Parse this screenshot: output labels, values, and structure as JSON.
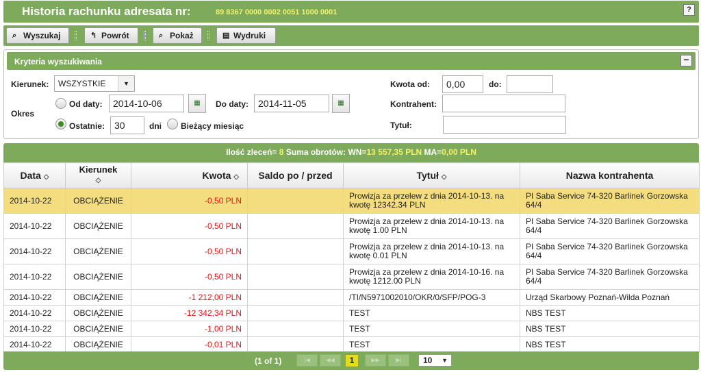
{
  "header": {
    "title": "Historia rachunku adresata nr:",
    "account": "89 8367 0000 0002 0051 1000 0001",
    "help_label": "?"
  },
  "toolbar": {
    "search_label": "Wyszukaj",
    "back_label": "Powrót",
    "show_label": "Pokaż",
    "print_label": "Wydruki"
  },
  "criteria": {
    "title": "Kryteria wyszukiwania",
    "collapse_label": "−",
    "direction_label": "Kierunek:",
    "direction_value": "WSZYSTKIE",
    "period_label": "Okres",
    "from_date_label": "Od daty:",
    "from_date_value": "2014-10-06",
    "to_date_label": "Do daty:",
    "to_date_value": "2014-11-05",
    "last_label": "Ostatnie:",
    "last_value": "30",
    "days_label": "dni",
    "current_month_label": "Bieżący miesiąc",
    "amount_from_label": "Kwota od:",
    "amount_from_value": "0,00",
    "amount_to_label": "do:",
    "amount_to_value": "",
    "counterparty_label": "Kontrahent:",
    "counterparty_value": "",
    "title_label": "Tytuł:",
    "title_value": ""
  },
  "summary": {
    "count_label": "Ilość zleceń=",
    "count_value": "8",
    "turnover_label": "Suma obrotów:",
    "wn_label": "WN=",
    "wn_value": "13 557,35 PLN",
    "ma_label": "MA=",
    "ma_value": "0,00 PLN"
  },
  "table": {
    "headers": {
      "date": "Data",
      "direction": "Kierunek",
      "amount": "Kwota",
      "balance": "Saldo po / przed",
      "title": "Tytuł",
      "counterparty": "Nazwa kontrahenta"
    },
    "rows": [
      {
        "date": "2014-10-22",
        "direction": "OBCIĄŻENIE",
        "amount": "-0,50 PLN",
        "balance": "",
        "title": "Prowizja za przelew z dnia 2014-10-13. na kwotę 12342.34 PLN",
        "counterparty": "PI Saba Service 74-320 Barlinek Gorzowska 64/4"
      },
      {
        "date": "2014-10-22",
        "direction": "OBCIĄŻENIE",
        "amount": "-0,50 PLN",
        "balance": "",
        "title": "Prowizja za przelew z dnia 2014-10-13. na kwotę 1.00 PLN",
        "counterparty": "PI Saba Service 74-320 Barlinek Gorzowska 64/4"
      },
      {
        "date": "2014-10-22",
        "direction": "OBCIĄŻENIE",
        "amount": "-0,50 PLN",
        "balance": "",
        "title": "Prowizja za przelew z dnia 2014-10-13. na kwotę 0.01 PLN",
        "counterparty": "PI Saba Service 74-320 Barlinek Gorzowska 64/4"
      },
      {
        "date": "2014-10-22",
        "direction": "OBCIĄŻENIE",
        "amount": "-0,50 PLN",
        "balance": "",
        "title": "Prowizja za przelew z dnia 2014-10-16. na kwotę 1212.00 PLN",
        "counterparty": "PI Saba Service 74-320 Barlinek Gorzowska 64/4"
      },
      {
        "date": "2014-10-22",
        "direction": "OBCIĄŻENIE",
        "amount": "-1 212,00 PLN",
        "balance": "",
        "title": "/TI/N5971002010/OKR/0/SFP/POG-3",
        "counterparty": "Urząd Skarbowy Poznań-Wilda Poznań"
      },
      {
        "date": "2014-10-22",
        "direction": "OBCIĄŻENIE",
        "amount": "-12 342,34 PLN",
        "balance": "",
        "title": "TEST",
        "counterparty": "NBS TEST"
      },
      {
        "date": "2014-10-22",
        "direction": "OBCIĄŻENIE",
        "amount": "-1,00 PLN",
        "balance": "",
        "title": "TEST",
        "counterparty": "NBS TEST"
      },
      {
        "date": "2014-10-22",
        "direction": "OBCIĄŻENIE",
        "amount": "-0,01 PLN",
        "balance": "",
        "title": "TEST",
        "counterparty": "NBS TEST"
      }
    ]
  },
  "pager": {
    "info": "(1 of 1)",
    "current_page": "1",
    "page_size": "10"
  },
  "colors": {
    "brand_green": "#7eaa5b",
    "accent_yellow": "#f3f26a",
    "selected_row": "#f3dd7e",
    "negative_amount": "#e21616"
  }
}
